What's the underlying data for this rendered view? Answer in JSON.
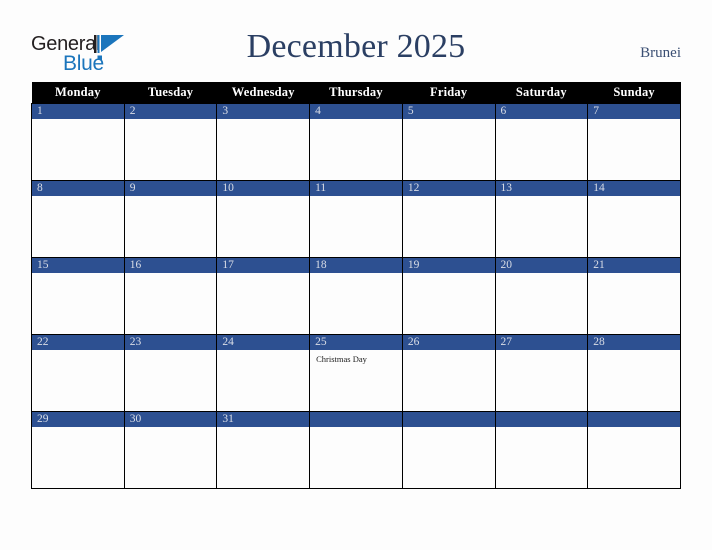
{
  "brand": {
    "name_part1": "General",
    "name_part2": "Blue",
    "mark_icon": "triangle-logo-icon",
    "accent_color": "#1b75bc",
    "text_color": "#231f20"
  },
  "header": {
    "title": "December 2025",
    "region": "Brunei",
    "title_color": "#2b3f63"
  },
  "calendar": {
    "month": "December",
    "year": "2025",
    "weekday_headers": [
      "Monday",
      "Tuesday",
      "Wednesday",
      "Thursday",
      "Friday",
      "Saturday",
      "Sunday"
    ],
    "header_bg": "#000000",
    "header_fg": "#ffffff",
    "day_bar_bg": "#2d5091",
    "day_bar_fg": "#d9dde6",
    "cell_bg": "#fdfdfd",
    "grid_line": "#000000",
    "weeks": [
      [
        {
          "day": "1",
          "events": []
        },
        {
          "day": "2",
          "events": []
        },
        {
          "day": "3",
          "events": []
        },
        {
          "day": "4",
          "events": []
        },
        {
          "day": "5",
          "events": []
        },
        {
          "day": "6",
          "events": []
        },
        {
          "day": "7",
          "events": []
        }
      ],
      [
        {
          "day": "8",
          "events": []
        },
        {
          "day": "9",
          "events": []
        },
        {
          "day": "10",
          "events": []
        },
        {
          "day": "11",
          "events": []
        },
        {
          "day": "12",
          "events": []
        },
        {
          "day": "13",
          "events": []
        },
        {
          "day": "14",
          "events": []
        }
      ],
      [
        {
          "day": "15",
          "events": []
        },
        {
          "day": "16",
          "events": []
        },
        {
          "day": "17",
          "events": []
        },
        {
          "day": "18",
          "events": []
        },
        {
          "day": "19",
          "events": []
        },
        {
          "day": "20",
          "events": []
        },
        {
          "day": "21",
          "events": []
        }
      ],
      [
        {
          "day": "22",
          "events": []
        },
        {
          "day": "23",
          "events": []
        },
        {
          "day": "24",
          "events": []
        },
        {
          "day": "25",
          "events": [
            "Christmas Day"
          ]
        },
        {
          "day": "26",
          "events": []
        },
        {
          "day": "27",
          "events": []
        },
        {
          "day": "28",
          "events": []
        }
      ],
      [
        {
          "day": "29",
          "events": []
        },
        {
          "day": "30",
          "events": []
        },
        {
          "day": "31",
          "events": []
        },
        {
          "day": "",
          "events": []
        },
        {
          "day": "",
          "events": []
        },
        {
          "day": "",
          "events": []
        },
        {
          "day": "",
          "events": []
        }
      ]
    ]
  }
}
